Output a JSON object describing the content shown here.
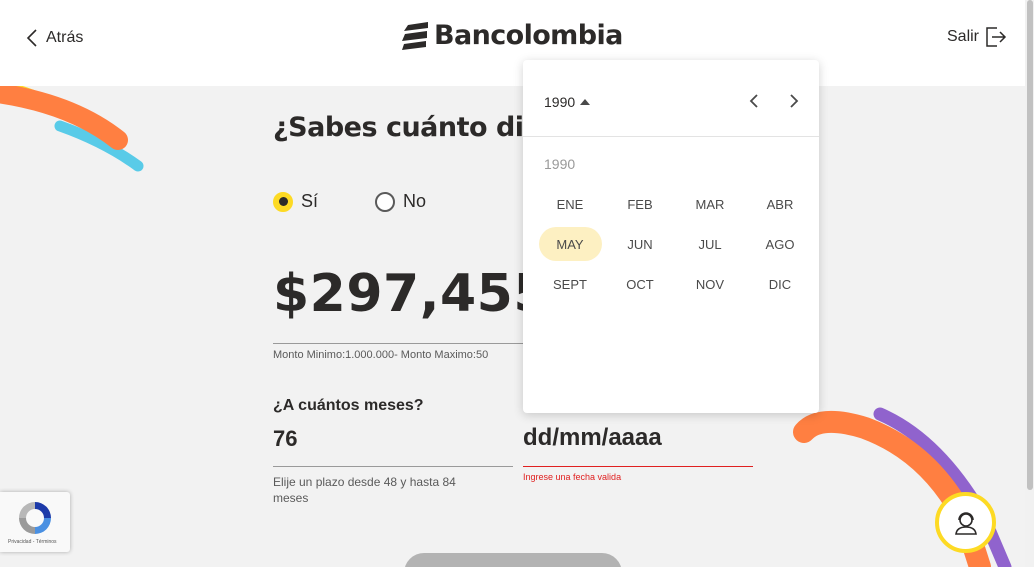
{
  "header": {
    "back_label": "Atrás",
    "brand": "Bancolombia",
    "exit_label": "Salir"
  },
  "question": {
    "title": "¿Sabes cuánto din",
    "options": [
      {
        "label": "Sí",
        "checked": true
      },
      {
        "label": "No",
        "checked": false
      }
    ]
  },
  "amount": {
    "value": "$297,455,",
    "hint": "Monto Minimo:1.000.000- Monto Maximo:50"
  },
  "term": {
    "label": "¿A cuántos meses?",
    "value": "76",
    "hint": "Elije un plazo desde 48 y hasta 84 meses"
  },
  "date_field": {
    "placeholder": "dd/mm/aaaa",
    "error": "Ingrese una fecha valida"
  },
  "datepicker": {
    "year_button": "1990",
    "year_row": "1990",
    "months": [
      "ENE",
      "FEB",
      "MAR",
      "ABR",
      "MAY",
      "JUN",
      "JUL",
      "AGO",
      "SEPT",
      "OCT",
      "NOV",
      "DIC"
    ],
    "selected_month": "MAY"
  },
  "recaptcha": {
    "footer": "Privacidad - Términos"
  },
  "colors": {
    "brand_yellow": "#fdda24",
    "orange": "#ff7f41",
    "blue": "#59cbe8",
    "purple": "#9063cd",
    "error_red": "#e02020"
  }
}
